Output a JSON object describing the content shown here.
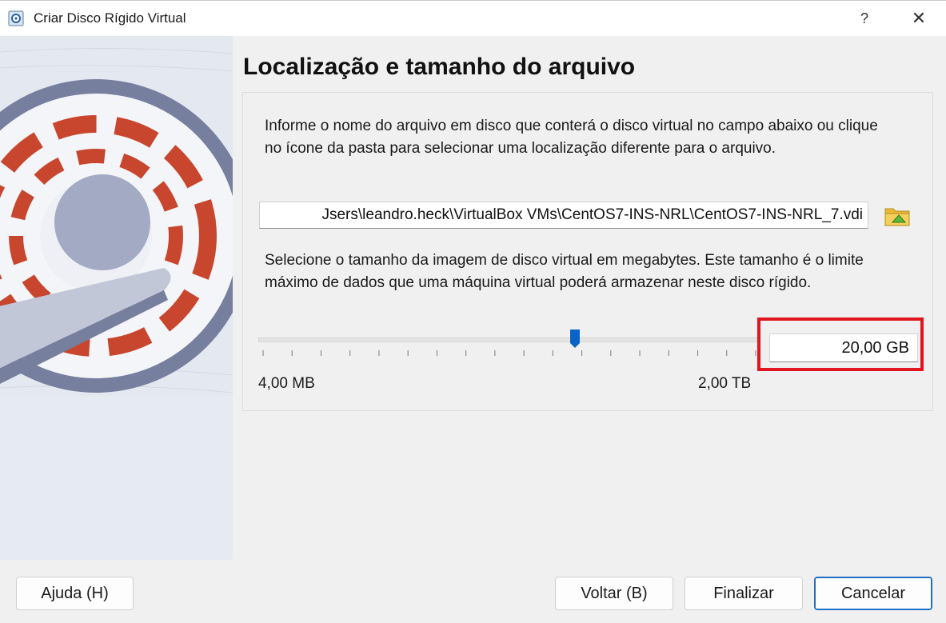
{
  "window": {
    "title": "Criar Disco Rígido Virtual",
    "help_glyph": "?",
    "close_glyph": "✕"
  },
  "page": {
    "heading": "Localização e tamanho do arquivo",
    "location_description": "Informe o nome do arquivo em disco que conterá o disco virtual no campo abaixo ou clique no ícone da pasta para selecionar uma localização diferente para o arquivo.",
    "file_path": "Jsers\\leandro.heck\\VirtualBox VMs\\CentOS7-INS-NRL\\CentOS7-INS-NRL_7.vdi",
    "size_description": "Selecione o tamanho da imagem de disco virtual em megabytes. Este tamanho é o limite máximo de dados que uma máquina virtual poderá armazenar neste disco rígido.",
    "size_value": "20,00 GB",
    "slider": {
      "min_label": "4,00 MB",
      "max_label": "2,00 TB",
      "position_fraction": 0.63,
      "tick_count": 18
    }
  },
  "buttons": {
    "help": "Ajuda (H)",
    "back": "Voltar (B)",
    "finish": "Finalizar",
    "cancel": "Cancelar"
  },
  "colors": {
    "highlight": "#e0151f",
    "slider_handle": "#0a64c8",
    "default_button_border": "#1f6fc4"
  },
  "icons": {
    "app": "virtualbox-disk-icon",
    "folder": "folder-browse-icon"
  }
}
